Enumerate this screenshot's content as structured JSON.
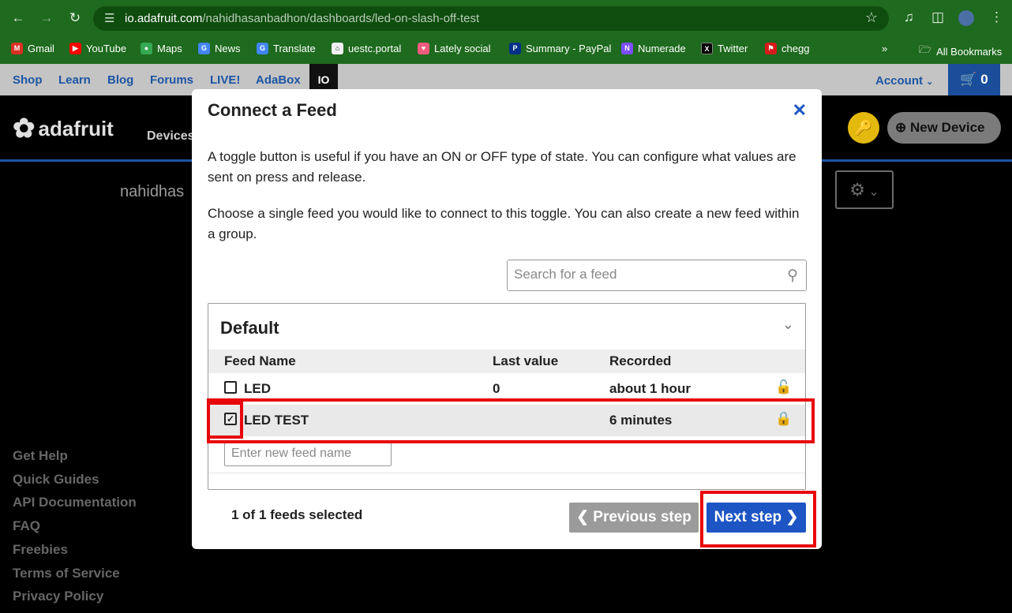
{
  "browser": {
    "url_host": "io.adafruit.com",
    "url_path": "/nahidhasanbadhon/dashboards/led-on-slash-off-test",
    "bookmarks": [
      {
        "label": "Gmail",
        "color": "#d93025"
      },
      {
        "label": "YouTube",
        "color": "#ff0000"
      },
      {
        "label": "Maps",
        "color": "#34a853"
      },
      {
        "label": "News",
        "color": "#4285f4"
      },
      {
        "label": "Translate",
        "color": "#4285f4"
      },
      {
        "label": "uestc.portal",
        "color": "#f0f0f0"
      },
      {
        "label": "Lately social",
        "color": "#ef5b7c"
      },
      {
        "label": "Summary - PayPal",
        "color": "#003087"
      },
      {
        "label": "Numerade",
        "color": "#7c4dff"
      },
      {
        "label": "Twitter",
        "color": "#000000"
      },
      {
        "label": "chegg",
        "color": "#d61a1a"
      }
    ],
    "all_bookmarks": "All Bookmarks"
  },
  "site_nav": {
    "links": [
      "Shop",
      "Learn",
      "Blog",
      "Forums",
      "LIVE!",
      "AdaBox"
    ],
    "io": "IO",
    "account": "Account",
    "cart_count": "0"
  },
  "page": {
    "logo": "adafruit",
    "devices": "Devices",
    "username": "nahidhas",
    "new_device": "New Device",
    "footer_links": [
      "Get Help",
      "Quick Guides",
      "API Documentation",
      "FAQ",
      "Freebies",
      "Terms of Service",
      "Privacy Policy"
    ]
  },
  "modal": {
    "title": "Connect a Feed",
    "para1": "A toggle button is useful if you have an ON or OFF type of state. You can configure what values are sent on press and release.",
    "para2": "Choose a single feed you would like to connect to this toggle. You can also create a new feed within a group.",
    "search_placeholder": "Search for a feed",
    "group_name": "Default",
    "columns": [
      "Feed Name",
      "Last value",
      "Recorded"
    ],
    "rows": [
      {
        "name": "LED",
        "last_value": "0",
        "recorded": "about 1 hour",
        "checked": false
      },
      {
        "name": "LED TEST",
        "last_value": "",
        "recorded": "6 minutes",
        "checked": true
      }
    ],
    "new_feed_placeholder": "Enter new feed name",
    "selected_count": "1 of 1 feeds selected",
    "prev_label": "Previous step",
    "next_label": "Next step"
  },
  "colors": {
    "chrome_green": "#1e6a1e",
    "adafruit_blue": "#1d55c4",
    "highlight_red": "#e8070b"
  }
}
